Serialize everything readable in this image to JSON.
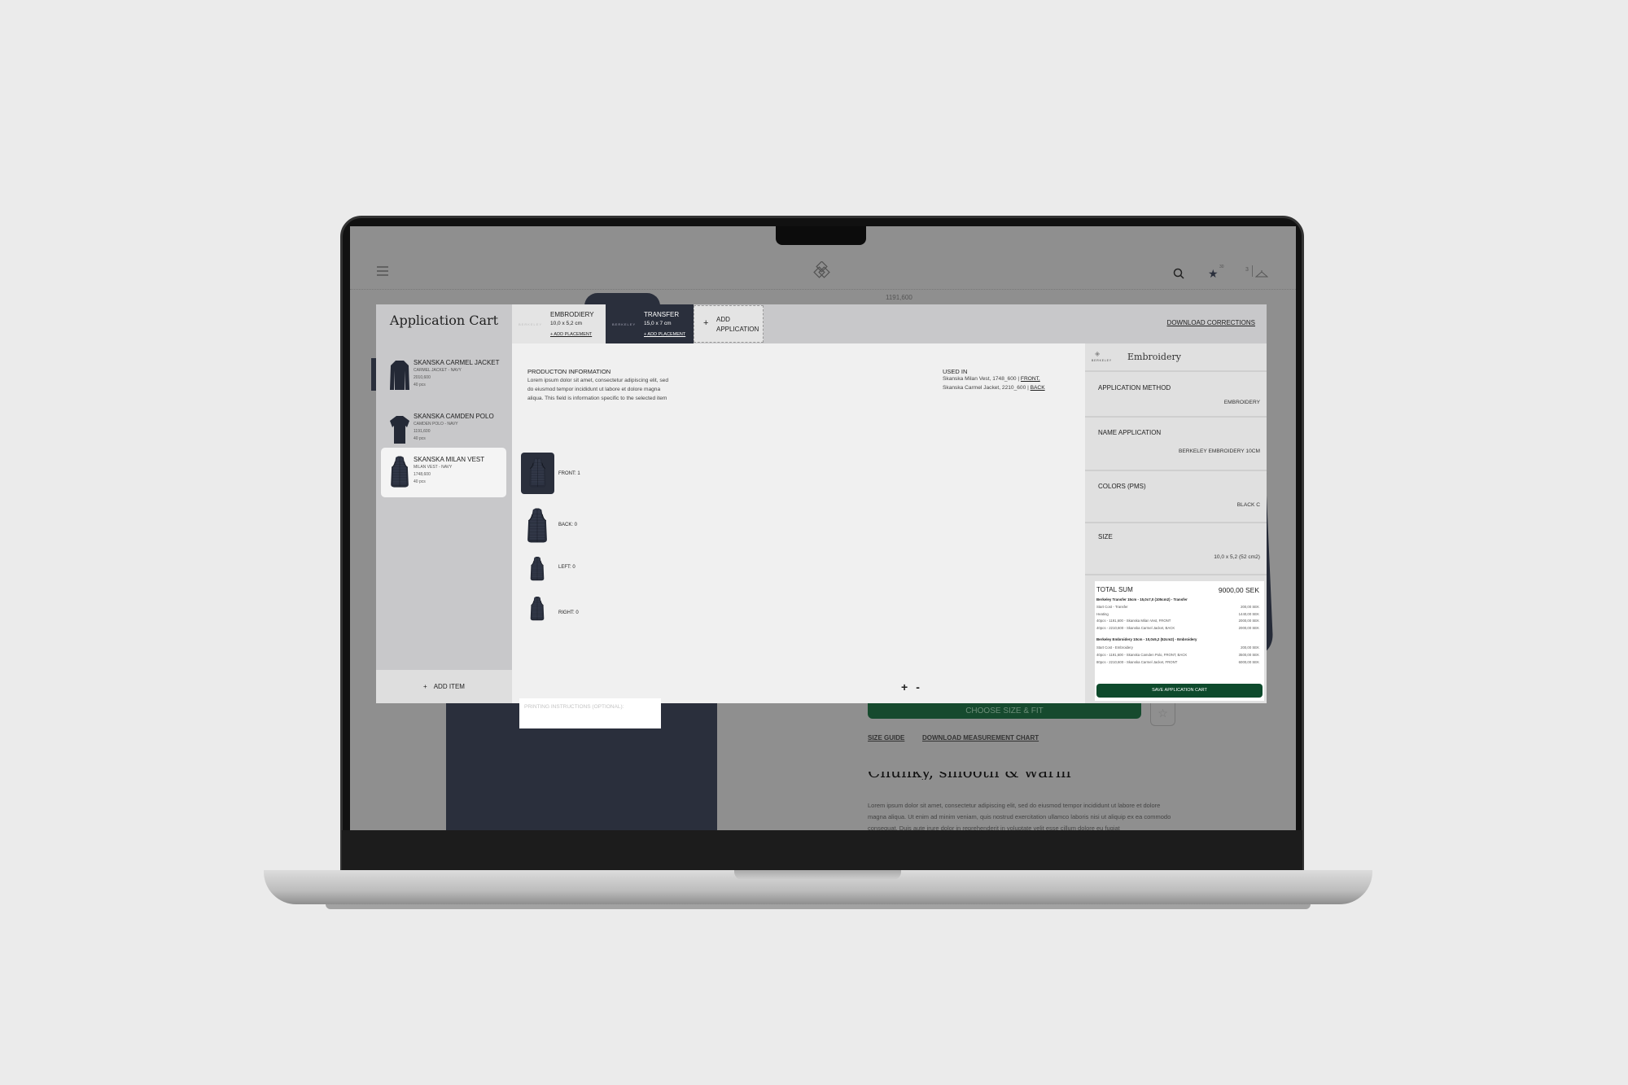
{
  "header": {
    "logo": "BERKELEY",
    "price_peek": "1191,600",
    "favorites_count": "30",
    "cart_count": "3"
  },
  "cart": {
    "title": "Application Cart",
    "items": [
      {
        "name": "SKANSKA CARMEL JACKET",
        "variant": "CARMEL JACKET - NAVY",
        "price": "2010,600",
        "qty": "40 pcs"
      },
      {
        "name": "SKANSKA CAMDEN POLO",
        "variant": "CAMDEN POLO - NAVY",
        "price": "1191,600",
        "qty": "40 pcs"
      },
      {
        "name": "SKANSKA MILAN VEST",
        "variant": "MILAN VEST - NAVY",
        "price": "1748,600",
        "qty": "40 pcs"
      }
    ],
    "selected": 2,
    "add_item": "ADD ITEM"
  },
  "tabs": [
    {
      "label": "EMBRODIERY",
      "size": "10,0 x 5,2 cm",
      "add_placement": "+ ADD PLACEMENT",
      "brand": "BERKELEY"
    },
    {
      "label": "TRANSFER",
      "size": "15,0 x 7 cm",
      "add_placement": "+ ADD PLACEMENT",
      "brand": "BERKELEY"
    }
  ],
  "add_application": {
    "line1": "ADD",
    "line2": "APPLICATION"
  },
  "download_corrections": "DOWNLOAD CORRECTIONS",
  "product_info": {
    "heading": "PRODUCTON INFORMATION",
    "body": "Lorem ipsum dolor sit amet, consectetur adipiscing elit, sed do eiusmod tempor incididunt ut labore et dolore magna aliqua. This field is information specific to the selected item"
  },
  "placements": [
    {
      "label": "FRONT: 1"
    },
    {
      "label": "BACK: 0"
    },
    {
      "label": "LEFT: 0"
    },
    {
      "label": "RIGHT: 0"
    }
  ],
  "printing_instructions_placeholder": "PRINTING INSTRUCTIONS (OPTIONAL):",
  "used_in": {
    "heading": "USED IN",
    "lines": [
      {
        "text": "Skanska Milan Vest, 1748_600 | ",
        "link": "FRONT,"
      },
      {
        "text": "Skanska Carmel Jacket, 2210_600 | ",
        "link": "BACK"
      }
    ]
  },
  "zoom": {
    "plus": "+",
    "minus": "-"
  },
  "details": {
    "brand": "BERKELEY",
    "title": "Embroidery",
    "rows": [
      {
        "label": "APPLICATION METHOD",
        "value": "EMBROIDERY"
      },
      {
        "label": "NAME APPLICATION",
        "value": "BERKELEY EMBROIDERY 10CM"
      },
      {
        "label": "COLORS (PMS)",
        "value": "BLACK C"
      },
      {
        "label": "SIZE",
        "value": "10,0 x 5,2 (52 cm2)"
      }
    ]
  },
  "total": {
    "label": "TOTAL SUM",
    "value": "9000,00  SEK",
    "groups": [
      {
        "title": "Berkeley Transfer 15cm - 15,0x7,0 (105cm2) - Transfer",
        "lines": [
          {
            "desc": "Start Cost - Transfer",
            "amount": "200,00 SEK"
          },
          {
            "desc": "Heating",
            "amount": "1440,00 SEK"
          },
          {
            "desc": "40pcs - 1191,600 - Skanska Milan Vest, FRONT",
            "amount": "2000,00 SEK"
          },
          {
            "desc": "40pcs - 2210,600 - Skanska Carmel Jacket, BACK",
            "amount": "2000,00 SEK"
          }
        ]
      },
      {
        "title": "Berkeley Embroidery 10cm - 10,0x5,2 (52cm2) - Embroidery",
        "lines": [
          {
            "desc": "Start Cost - Embroidery",
            "amount": "200,00 SEK"
          },
          {
            "desc": "40pcs - 1191,600 - Skanska Camden Polo, FRONT, BACK",
            "amount": "3500,00 SEK"
          },
          {
            "desc": "80pcs - 2210,600 - Skanska Carmel Jacket, FRONT",
            "amount": "6000,00 SEK"
          }
        ]
      }
    ],
    "save": "SAVE APPLICATION CART"
  },
  "background_page": {
    "choose_size": "CHOOSE SIZE & FIT",
    "size_guide": "SIZE GUIDE",
    "download_chart": "DOWNLOAD MEASUREMENT CHART",
    "heading": "Chunky, smooth & warm",
    "paragraph": "Lorem ipsum dolor sit amet, consectetur adipiscing elit, sed do eiusmod tempor incididunt ut labore et dolore magna aliqua. Ut enim ad minim veniam, quis nostrud exercitation ullamco laboris nisi ut aliquip ex ea commodo consequat. Duis aute irure dolor in reprehenderit in voluptate velit esse cillum dolore eu fugiat"
  },
  "colors": {
    "accent_green": "#0e4a2c",
    "navy": "#2a2f3c",
    "overlay_gray": "#8f8f8f"
  }
}
